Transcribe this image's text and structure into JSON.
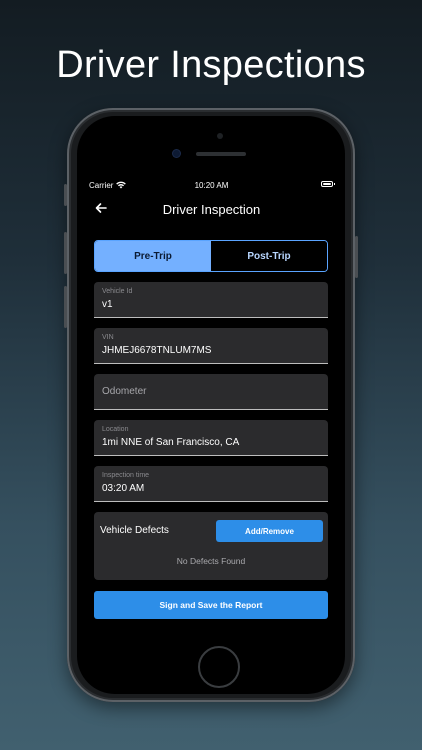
{
  "headline": "Driver Inspections",
  "status_bar": {
    "carrier": "Carrier",
    "time": "10:20 AM"
  },
  "navbar": {
    "title": "Driver Inspection",
    "back_icon": "arrow-left-icon"
  },
  "tabs": [
    {
      "label": "Pre-Trip",
      "active": true
    },
    {
      "label": "Post-Trip",
      "active": false
    }
  ],
  "fields": {
    "vehicle_id": {
      "label": "Vehicle Id",
      "value": "v1"
    },
    "vin": {
      "label": "VIN",
      "value": "JHMEJ6678TNLUM7MS"
    },
    "odometer": {
      "placeholder": "Odometer",
      "value": ""
    },
    "location": {
      "label": "Location",
      "value": "1mi NNE of San Francisco, CA"
    },
    "inspection_time": {
      "label": "Inspection time",
      "value": "03:20 AM"
    }
  },
  "defects": {
    "title": "Vehicle Defects",
    "add_button": "Add/Remove",
    "empty_text": "No Defects Found"
  },
  "save_button": "Sign and Save the Report",
  "colors": {
    "accent": "#2d8ee8",
    "tab_active": "#74b0ff",
    "field_bg": "#2b2b2d"
  }
}
